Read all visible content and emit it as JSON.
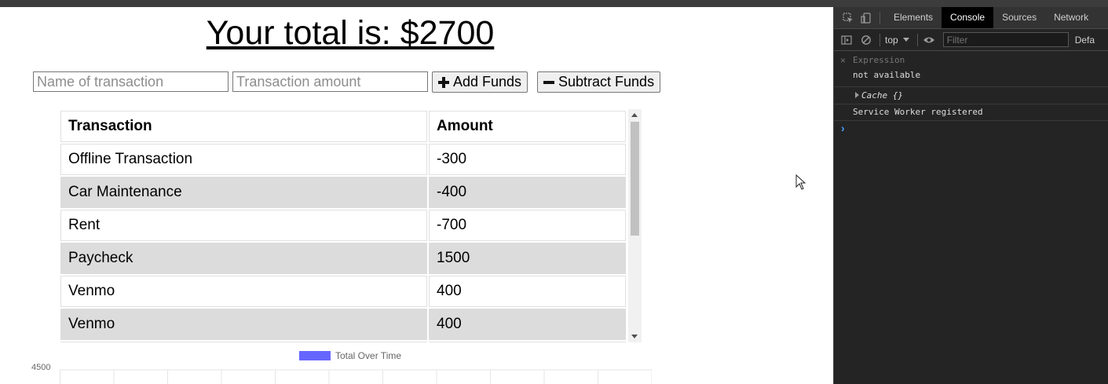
{
  "page": {
    "total_text": "Your total is: $2700",
    "name_placeholder": "Name of transaction",
    "amount_placeholder": "Transaction amount",
    "add_label": "Add Funds",
    "subtract_label": "Subtract Funds",
    "table": {
      "headers": [
        "Transaction",
        "Amount"
      ],
      "rows": [
        {
          "name": "Offline Transaction",
          "amount": "-300"
        },
        {
          "name": "Car Maintenance",
          "amount": "-400"
        },
        {
          "name": "Rent",
          "amount": "-700"
        },
        {
          "name": "Paycheck",
          "amount": "1500"
        },
        {
          "name": "Venmo",
          "amount": "400"
        },
        {
          "name": "Venmo",
          "amount": "400"
        }
      ]
    },
    "chart": {
      "legend": "Total Over Time",
      "legend_color": "#6666ff",
      "y_top_tick": "4500"
    }
  },
  "devtools": {
    "tabs": [
      "Elements",
      "Console",
      "Sources",
      "Network"
    ],
    "active_tab": "Console",
    "context": "top",
    "filter_placeholder": "Filter",
    "default_levels": "Defa",
    "expression_label": "Expression",
    "expression_value": "not available",
    "log_cache": "Cache {}",
    "log_message": "Service Worker registered",
    "prompt": "›"
  }
}
